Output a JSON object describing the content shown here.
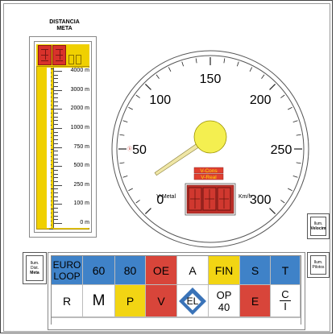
{
  "distance_meter": {
    "title_line1": "DISTANCIA",
    "title_line2": "META",
    "scale_labels": [
      "4000 m",
      "3000 m",
      "2000 m",
      "1000 m",
      "750 m",
      "500 m",
      "250 m",
      "100 m",
      "0 m"
    ]
  },
  "speedometer": {
    "labels": [
      "0",
      "50",
      "100",
      "150",
      "200",
      "250",
      "300"
    ],
    "unit": "Km/h",
    "v_cons_label": "V-Cons",
    "v_real_label": "V-Real",
    "v_metal_label": "V-Metal",
    "needle_value_kmh": 12
  },
  "illum_buttons": {
    "velocim": {
      "line1": "Ilum.",
      "line2": "Velocim"
    },
    "pilotos": {
      "line1": "Ilum.",
      "line2": "Pilotos"
    },
    "dist_meta": {
      "line1": "Ilum.",
      "line2": "Dist.",
      "line3": "Meta"
    }
  },
  "signal_panel": {
    "row1": [
      {
        "label_a": "EURO",
        "label_b": "LOOP",
        "color": "blue"
      },
      {
        "label": "60",
        "color": "blue"
      },
      {
        "label": "80",
        "color": "blue"
      },
      {
        "label": "OE",
        "color": "red"
      },
      {
        "label": "A",
        "color": "white"
      },
      {
        "label": "FIN",
        "color": "yellow"
      },
      {
        "label": "S",
        "color": "blue"
      },
      {
        "label": "T",
        "color": "blue"
      }
    ],
    "row2": [
      {
        "label": "R",
        "color": "white"
      },
      {
        "label": "M",
        "color": "white"
      },
      {
        "label": "P",
        "color": "yellow"
      },
      {
        "label": "V",
        "color": "red"
      },
      {
        "label": "EL",
        "color": "white"
      },
      {
        "label_a": "OP",
        "label_b": "40",
        "color": "white"
      },
      {
        "label": "E",
        "color": "red"
      },
      {
        "label_a": "C",
        "label_b": "I",
        "color": "white"
      }
    ]
  },
  "colors": {
    "yellow": "#f0d000",
    "red": "#d8322b",
    "blue": "#3f82c8"
  }
}
